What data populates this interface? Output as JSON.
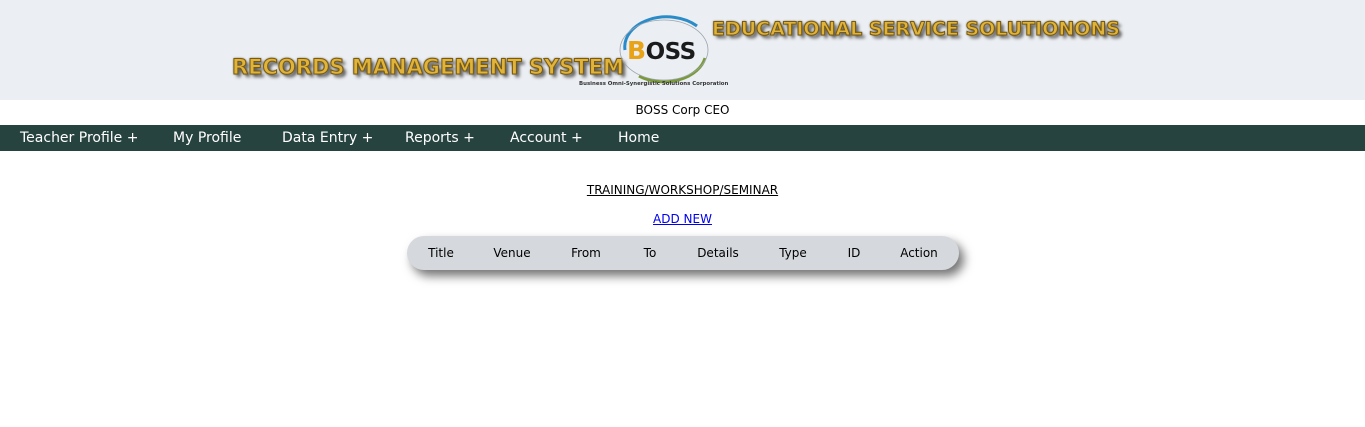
{
  "header": {
    "system_title": "RECORDS MANAGEMENT SYSTEM",
    "company_tagline": "EDUCATIONAL SERVICE SOLUTIONONS",
    "logo": {
      "initial": "B",
      "rest": "OSS",
      "subtitle": "Business Omni-Synergistic Solutions Corporation",
      "ring_colors": [
        "#2a8bc9",
        "#7a9a3a"
      ]
    },
    "text_color": "#e0b43a",
    "background": "#ebeef2"
  },
  "user": {
    "name": "BOSS Corp CEO"
  },
  "nav": {
    "background": "#27433f",
    "items": [
      {
        "label": "Teacher Profile +"
      },
      {
        "label": "My Profile"
      },
      {
        "label": "Data Entry +"
      },
      {
        "label": "Reports +"
      },
      {
        "label": "Account +"
      },
      {
        "label": "Home"
      }
    ]
  },
  "main": {
    "section_title": "TRAINING/WORKSHOP/SEMINAR",
    "add_new_label": "ADD NEW",
    "table": {
      "columns": [
        "Title",
        "Venue",
        "From",
        "To",
        "Details",
        "Type",
        "ID",
        "Action"
      ],
      "rows": []
    }
  }
}
